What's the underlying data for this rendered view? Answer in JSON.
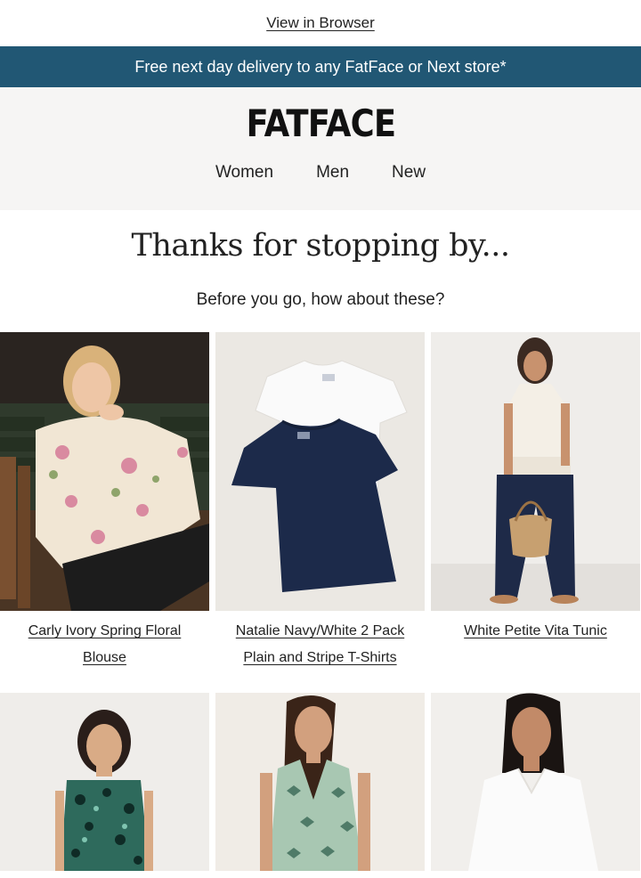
{
  "header": {
    "view_in_browser": "View in Browser"
  },
  "promo": {
    "text": "Free next day delivery to any FatFace or Next store*"
  },
  "brand": {
    "logo": "FATFACE"
  },
  "nav": [
    {
      "label": "Women"
    },
    {
      "label": "Men"
    },
    {
      "label": "New"
    }
  ],
  "content": {
    "headline": "Thanks for stopping by...",
    "subheadline": "Before you go, how about these?"
  },
  "products": [
    {
      "name": "Carly Ivory Spring Floral Blouse"
    },
    {
      "name": "Natalie Navy/White 2 Pack Plain and Stripe T-Shirts"
    },
    {
      "name": "White Petite Vita Tunic"
    },
    {
      "name": ""
    },
    {
      "name": ""
    },
    {
      "name": ""
    }
  ],
  "colors": {
    "promo_bar": "#215774",
    "band": "#f6f5f4",
    "text": "#222222"
  }
}
